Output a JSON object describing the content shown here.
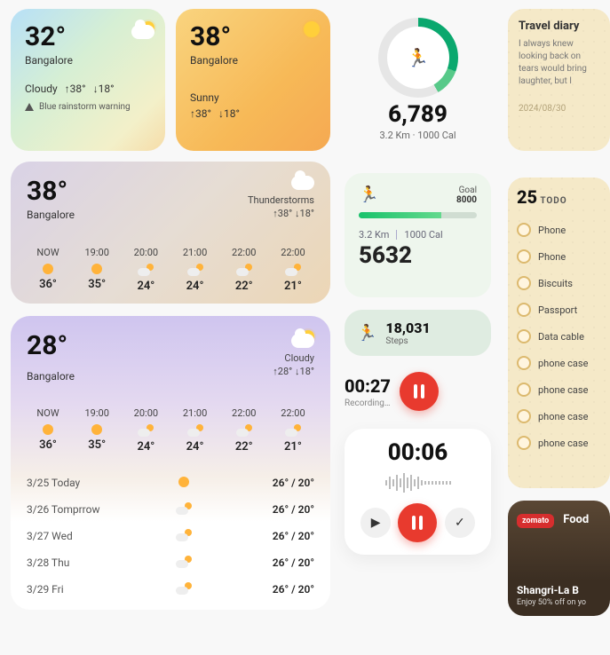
{
  "weather_small": [
    {
      "temp": "32",
      "city": "Bangalore",
      "condition": "Cloudy",
      "high": "38",
      "low": "18",
      "warning": "Blue rainstorm warning"
    },
    {
      "temp": "38",
      "city": "Bangalore",
      "condition": "Sunny",
      "high": "38",
      "low": "18"
    }
  ],
  "weather_med": {
    "temp": "38",
    "city": "Bangalore",
    "condition": "Thunderstorms",
    "high": "38",
    "low": "18",
    "hours": [
      {
        "label": "NOW",
        "temp": "36"
      },
      {
        "label": "19:00",
        "temp": "35"
      },
      {
        "label": "20:00",
        "temp": "24"
      },
      {
        "label": "21:00",
        "temp": "24"
      },
      {
        "label": "22:00",
        "temp": "22"
      },
      {
        "label": "22:00",
        "temp": "21"
      }
    ]
  },
  "weather_lg": {
    "temp": "28",
    "city": "Bangalore",
    "condition": "Cloudy",
    "high": "28",
    "low": "18",
    "hours": [
      {
        "label": "NOW",
        "temp": "36"
      },
      {
        "label": "19:00",
        "temp": "35"
      },
      {
        "label": "20:00",
        "temp": "24"
      },
      {
        "label": "21:00",
        "temp": "24"
      },
      {
        "label": "22:00",
        "temp": "22"
      },
      {
        "label": "22:00",
        "temp": "21"
      }
    ],
    "days": [
      {
        "label": "3/25 Today",
        "range": "26° / 20°"
      },
      {
        "label": "3/26 Tomprrow",
        "range": "26° / 20°"
      },
      {
        "label": "3/27 Wed",
        "range": "26° / 20°"
      },
      {
        "label": "3/28 Thu",
        "range": "26° / 20°"
      },
      {
        "label": "3/29 Fri",
        "range": "26° / 20°"
      }
    ]
  },
  "fitness_ring": {
    "steps": "6,789",
    "sub": "3.2 Km · 1000 Cal"
  },
  "fitness_card": {
    "goal_label": "Goal",
    "goal_value": "8000",
    "distance": "3.2 Km",
    "cal": "1000 Cal",
    "steps": "5632"
  },
  "step_pill": {
    "value": "18,031",
    "label": "Steps"
  },
  "recorder_mini": {
    "time": "00:27",
    "label": "Recording…"
  },
  "timer": {
    "time": "00:06"
  },
  "diary": {
    "title": "Travel diary",
    "body": "I always knew looking back on tears would bring laughter, but I",
    "date": "2024/08/30"
  },
  "todo": {
    "count": "25",
    "label": "TODO",
    "items": [
      "Phone",
      "Phone",
      "Biscuits",
      "Passport",
      "Data cable",
      "phone case",
      "phone case",
      "phone case",
      "phone case"
    ]
  },
  "food": {
    "brand": "zomato",
    "tag": "Food",
    "title": "Shangri-La B",
    "sub": "Enjoy 50% off on yo"
  }
}
